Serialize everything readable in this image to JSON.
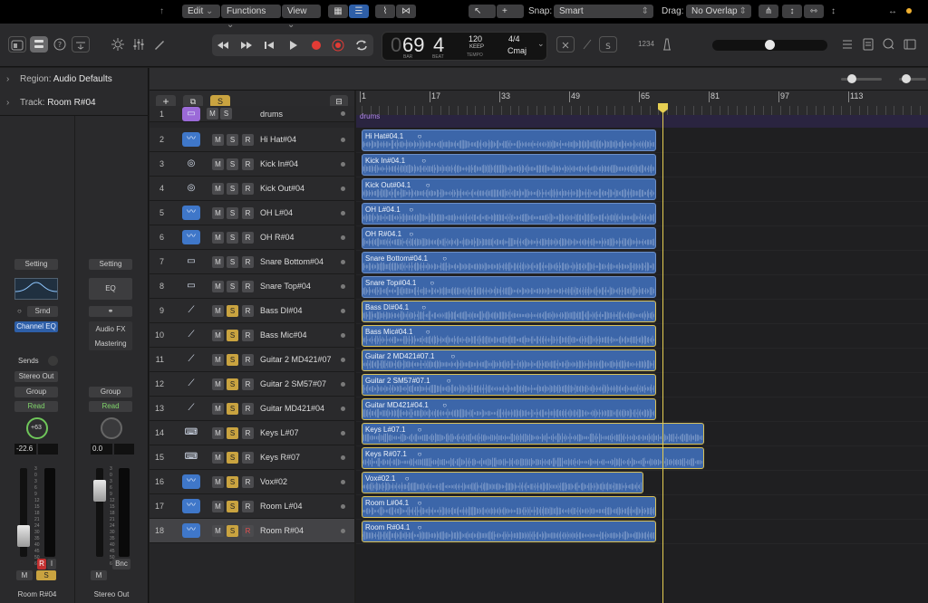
{
  "transport": {
    "bar_prefix": "0",
    "bar": "69",
    "beat": "4",
    "bar_label": "BAR",
    "beat_label": "BEAT",
    "tempo": "120",
    "tempo_mode": "KEEP",
    "tempo_label": "TEMPO",
    "signature": "4/4",
    "key": "Cmaj",
    "count_in": "1234",
    "master_volume_fraction": 0.5
  },
  "inspector": {
    "region_label": "Region:",
    "region_value": "Audio Defaults",
    "track_label": "Track:",
    "track_value": "Room R#04"
  },
  "strip1": {
    "setting": "Setting",
    "srnd": "Srnd",
    "channel_eq": "Channel EQ",
    "sends": "Sends",
    "output": "Stereo Out",
    "group": "Group",
    "automation": "Read",
    "pan": "+63",
    "volume": "-22.6",
    "mute": "M",
    "solo": "S",
    "record": "R",
    "input_monitor": "I",
    "name": "Room R#04"
  },
  "strip2": {
    "setting": "Setting",
    "eq": "EQ",
    "audio_fx": "Audio FX",
    "mastering": "Mastering",
    "group": "Group",
    "automation": "Read",
    "volume": "0.0",
    "bounce": "Bnc",
    "mute": "M",
    "name": "Stereo Out"
  },
  "meter_scale": [
    "3",
    "0",
    "3",
    "6",
    "9",
    "12",
    "15",
    "18",
    "21",
    "24",
    "30",
    "35",
    "40",
    "45",
    "50",
    "60"
  ],
  "toolbar": {
    "edit": "Edit",
    "functions": "Functions",
    "view": "View",
    "snap_label": "Snap:",
    "snap_value": "Smart",
    "drag_label": "Drag:",
    "drag_value": "No Overlap"
  },
  "ruler": [
    "1",
    "17",
    "33",
    "49",
    "65",
    "81",
    "97",
    "113"
  ],
  "folder": {
    "number": "1",
    "name": "drums",
    "mute": "M",
    "solo": "S"
  },
  "tracks": [
    {
      "num": "2",
      "name": "Hi Hat#04",
      "icon": "waveform-icon",
      "solo_on": false,
      "region": "Hi Hat#04.1",
      "end": 65
    },
    {
      "num": "3",
      "name": "Kick In#04",
      "icon": "bass-drum-icon",
      "solo_on": false,
      "region": "Kick In#04.1",
      "end": 65
    },
    {
      "num": "4",
      "name": "Kick Out#04",
      "icon": "bass-drum-icon",
      "solo_on": false,
      "region": "Kick Out#04.1",
      "end": 65
    },
    {
      "num": "5",
      "name": "OH L#04",
      "icon": "waveform-icon",
      "solo_on": false,
      "region": "OH L#04.1",
      "end": 65
    },
    {
      "num": "6",
      "name": "OH R#04",
      "icon": "waveform-icon",
      "solo_on": false,
      "region": "OH R#04.1",
      "end": 65
    },
    {
      "num": "7",
      "name": "Snare Bottom#04",
      "icon": "snare-drum-icon",
      "solo_on": false,
      "region": "Snare Bottom#04.1",
      "end": 65
    },
    {
      "num": "8",
      "name": "Snare Top#04",
      "icon": "snare-drum-icon",
      "solo_on": false,
      "region": "Snare Top#04.1",
      "end": 65
    },
    {
      "num": "9",
      "name": "Bass DI#04",
      "icon": "bass-guitar-icon",
      "solo_on": true,
      "region": "Bass DI#04.1",
      "end": 65
    },
    {
      "num": "10",
      "name": "Bass Mic#04",
      "icon": "bass-guitar-icon",
      "solo_on": true,
      "region": "Bass Mic#04.1",
      "end": 65
    },
    {
      "num": "11",
      "name": "Guitar 2 MD421#07",
      "icon": "guitar-icon",
      "solo_on": true,
      "region": "Guitar 2 MD421#07.1",
      "end": 65
    },
    {
      "num": "12",
      "name": "Guitar 2 SM57#07",
      "icon": "guitar-icon",
      "solo_on": true,
      "region": "Guitar 2 SM57#07.1",
      "end": 65
    },
    {
      "num": "13",
      "name": "Guitar MD421#04",
      "icon": "guitar-icon",
      "solo_on": true,
      "region": "Guitar MD421#04.1",
      "end": 65
    },
    {
      "num": "14",
      "name": "Keys L#07",
      "icon": "keyboard-icon",
      "solo_on": true,
      "region": "Keys L#07.1",
      "end": 76
    },
    {
      "num": "15",
      "name": "Keys R#07",
      "icon": "keyboard-icon",
      "solo_on": true,
      "region": "Keys R#07.1",
      "end": 76
    },
    {
      "num": "16",
      "name": "Vox#02",
      "icon": "waveform-icon",
      "solo_on": true,
      "region": "Vox#02.1",
      "end": 62
    },
    {
      "num": "17",
      "name": "Room L#04",
      "icon": "waveform-icon",
      "solo_on": true,
      "region": "Room L#04.1",
      "end": 65
    },
    {
      "num": "18",
      "name": "Room R#04",
      "icon": "waveform-icon",
      "solo_on": true,
      "region": "Room R#04.1",
      "end": 65,
      "selected": true
    }
  ],
  "track_buttons": {
    "mute": "M",
    "solo": "S",
    "record": "R"
  },
  "colors": {
    "region": "#3c66a9",
    "solo": "#c9a340",
    "playhead": "#e6cf52",
    "folder": "#9b6ad8"
  }
}
